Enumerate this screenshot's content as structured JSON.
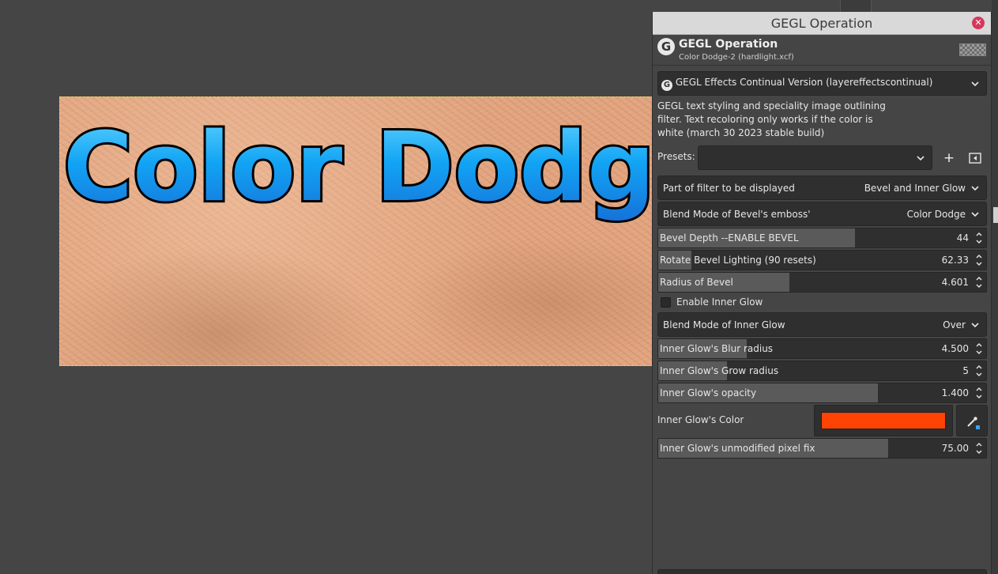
{
  "canvas": {
    "text": "Color Dodge"
  },
  "panel": {
    "window_title": "GEGL Operation",
    "header_title": "GEGL Operation",
    "header_subtitle": "Color Dodge-2 (hardlight.xcf)",
    "operation_select": "GEGL Effects Continual Version (layereffectscontinual)",
    "description": "GEGL text styling and speciality image outlining filter. Text recoloring only works if the color is white (march 30 2023 stable build)",
    "presets_label": "Presets:",
    "presets_value": "",
    "part_label": "Part of filter to be displayed",
    "part_value": "Bevel and Inner Glow",
    "bevel_blend_label": "Blend Mode of Bevel's emboss'",
    "bevel_blend_value": "Color Dodge",
    "bevel_depth": {
      "label": "Bevel Depth --ENABLE BEVEL",
      "value": "44",
      "fill": 0.6
    },
    "rotate_bevel": {
      "label": "Rotate Bevel Lighting (90 resets)",
      "value": "62.33",
      "fill": 0.1
    },
    "radius_bevel": {
      "label": "Radius of Bevel",
      "value": "4.601",
      "fill": 0.4
    },
    "enable_inner_glow": "Enable Inner Glow",
    "inner_blend_label": "Blend Mode of Inner Glow",
    "inner_blend_value": "Over",
    "blur_radius": {
      "label": "Inner Glow's Blur radius",
      "value": "4.500",
      "fill": 0.27
    },
    "grow_radius": {
      "label": "Inner Glow's Grow radius",
      "value": "5",
      "fill": 0.21
    },
    "opacity": {
      "label": "Inner Glow's opacity",
      "value": "1.400",
      "fill": 0.67
    },
    "color_label": "Inner Glow's Color",
    "inner_glow_color": "#ff4304",
    "pixel_fix": {
      "label": "Inner Glow's unmodified pixel fix",
      "value": "75.00",
      "fill": 0.7
    }
  }
}
